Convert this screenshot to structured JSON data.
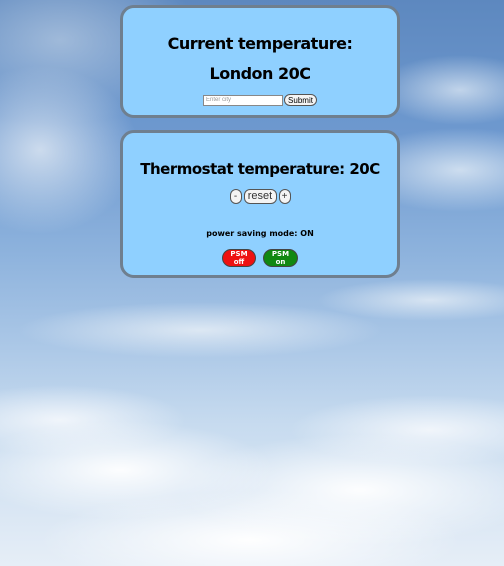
{
  "current": {
    "title": "Current temperature:",
    "city_temp": "London 20C",
    "input_placeholder": "Enter city",
    "input_value": "",
    "submit_label": "Submit"
  },
  "thermostat": {
    "title": "Thermostat temperature: 20C",
    "decrease_label": "-",
    "reset_label": "reset",
    "increase_label": "+",
    "psm_status": "power saving mode: ON",
    "psm_off_label": "PSM off",
    "psm_on_label": "PSM on"
  },
  "colors": {
    "panel_bg": "#8fd0ff",
    "panel_border": "#6f7f8f",
    "psm_off": "#ee1111",
    "psm_on": "#118811"
  }
}
